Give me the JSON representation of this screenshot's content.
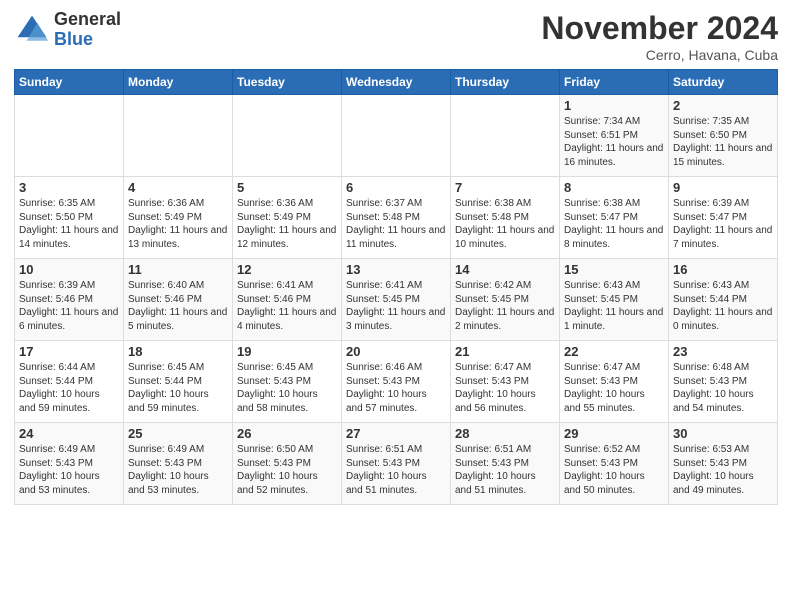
{
  "header": {
    "logo_general": "General",
    "logo_blue": "Blue",
    "title": "November 2024",
    "location": "Cerro, Havana, Cuba"
  },
  "weekdays": [
    "Sunday",
    "Monday",
    "Tuesday",
    "Wednesday",
    "Thursday",
    "Friday",
    "Saturday"
  ],
  "weeks": [
    [
      {
        "day": "",
        "info": ""
      },
      {
        "day": "",
        "info": ""
      },
      {
        "day": "",
        "info": ""
      },
      {
        "day": "",
        "info": ""
      },
      {
        "day": "",
        "info": ""
      },
      {
        "day": "1",
        "info": "Sunrise: 7:34 AM\nSunset: 6:51 PM\nDaylight: 11 hours and 16 minutes."
      },
      {
        "day": "2",
        "info": "Sunrise: 7:35 AM\nSunset: 6:50 PM\nDaylight: 11 hours and 15 minutes."
      }
    ],
    [
      {
        "day": "3",
        "info": "Sunrise: 6:35 AM\nSunset: 5:50 PM\nDaylight: 11 hours and 14 minutes."
      },
      {
        "day": "4",
        "info": "Sunrise: 6:36 AM\nSunset: 5:49 PM\nDaylight: 11 hours and 13 minutes."
      },
      {
        "day": "5",
        "info": "Sunrise: 6:36 AM\nSunset: 5:49 PM\nDaylight: 11 hours and 12 minutes."
      },
      {
        "day": "6",
        "info": "Sunrise: 6:37 AM\nSunset: 5:48 PM\nDaylight: 11 hours and 11 minutes."
      },
      {
        "day": "7",
        "info": "Sunrise: 6:38 AM\nSunset: 5:48 PM\nDaylight: 11 hours and 10 minutes."
      },
      {
        "day": "8",
        "info": "Sunrise: 6:38 AM\nSunset: 5:47 PM\nDaylight: 11 hours and 8 minutes."
      },
      {
        "day": "9",
        "info": "Sunrise: 6:39 AM\nSunset: 5:47 PM\nDaylight: 11 hours and 7 minutes."
      }
    ],
    [
      {
        "day": "10",
        "info": "Sunrise: 6:39 AM\nSunset: 5:46 PM\nDaylight: 11 hours and 6 minutes."
      },
      {
        "day": "11",
        "info": "Sunrise: 6:40 AM\nSunset: 5:46 PM\nDaylight: 11 hours and 5 minutes."
      },
      {
        "day": "12",
        "info": "Sunrise: 6:41 AM\nSunset: 5:46 PM\nDaylight: 11 hours and 4 minutes."
      },
      {
        "day": "13",
        "info": "Sunrise: 6:41 AM\nSunset: 5:45 PM\nDaylight: 11 hours and 3 minutes."
      },
      {
        "day": "14",
        "info": "Sunrise: 6:42 AM\nSunset: 5:45 PM\nDaylight: 11 hours and 2 minutes."
      },
      {
        "day": "15",
        "info": "Sunrise: 6:43 AM\nSunset: 5:45 PM\nDaylight: 11 hours and 1 minute."
      },
      {
        "day": "16",
        "info": "Sunrise: 6:43 AM\nSunset: 5:44 PM\nDaylight: 11 hours and 0 minutes."
      }
    ],
    [
      {
        "day": "17",
        "info": "Sunrise: 6:44 AM\nSunset: 5:44 PM\nDaylight: 10 hours and 59 minutes."
      },
      {
        "day": "18",
        "info": "Sunrise: 6:45 AM\nSunset: 5:44 PM\nDaylight: 10 hours and 59 minutes."
      },
      {
        "day": "19",
        "info": "Sunrise: 6:45 AM\nSunset: 5:43 PM\nDaylight: 10 hours and 58 minutes."
      },
      {
        "day": "20",
        "info": "Sunrise: 6:46 AM\nSunset: 5:43 PM\nDaylight: 10 hours and 57 minutes."
      },
      {
        "day": "21",
        "info": "Sunrise: 6:47 AM\nSunset: 5:43 PM\nDaylight: 10 hours and 56 minutes."
      },
      {
        "day": "22",
        "info": "Sunrise: 6:47 AM\nSunset: 5:43 PM\nDaylight: 10 hours and 55 minutes."
      },
      {
        "day": "23",
        "info": "Sunrise: 6:48 AM\nSunset: 5:43 PM\nDaylight: 10 hours and 54 minutes."
      }
    ],
    [
      {
        "day": "24",
        "info": "Sunrise: 6:49 AM\nSunset: 5:43 PM\nDaylight: 10 hours and 53 minutes."
      },
      {
        "day": "25",
        "info": "Sunrise: 6:49 AM\nSunset: 5:43 PM\nDaylight: 10 hours and 53 minutes."
      },
      {
        "day": "26",
        "info": "Sunrise: 6:50 AM\nSunset: 5:43 PM\nDaylight: 10 hours and 52 minutes."
      },
      {
        "day": "27",
        "info": "Sunrise: 6:51 AM\nSunset: 5:43 PM\nDaylight: 10 hours and 51 minutes."
      },
      {
        "day": "28",
        "info": "Sunrise: 6:51 AM\nSunset: 5:43 PM\nDaylight: 10 hours and 51 minutes."
      },
      {
        "day": "29",
        "info": "Sunrise: 6:52 AM\nSunset: 5:43 PM\nDaylight: 10 hours and 50 minutes."
      },
      {
        "day": "30",
        "info": "Sunrise: 6:53 AM\nSunset: 5:43 PM\nDaylight: 10 hours and 49 minutes."
      }
    ]
  ]
}
